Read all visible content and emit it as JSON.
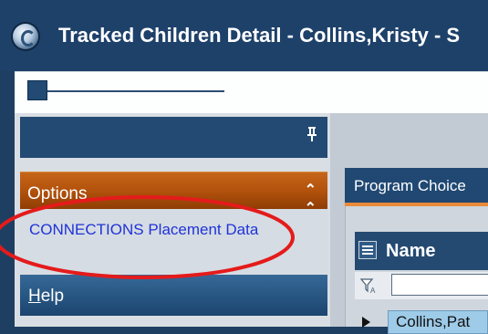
{
  "window": {
    "title": "Tracked Children Detail - Collins,Kristy - S"
  },
  "toolbar": {
    "zoom_slider": {
      "value": 0.0
    }
  },
  "left_panel": {
    "options": {
      "label": "Options",
      "link": "CONNECTIONS Placement Data"
    },
    "help": {
      "mnemonic": "H",
      "rest": "elp"
    }
  },
  "right_panel": {
    "tab_label": "Program Choice",
    "grid": {
      "column_header": "Name",
      "filter_value": "",
      "rows": [
        {
          "name": "Collins,Pat"
        }
      ]
    }
  },
  "colors": {
    "title_bar": "#1e416a",
    "options_bar": "#b2520c",
    "help_bar": "#285783",
    "link": "#2033d8",
    "selected_row": "#9ecbe8",
    "annotation_ellipse": "#e41b1b"
  }
}
